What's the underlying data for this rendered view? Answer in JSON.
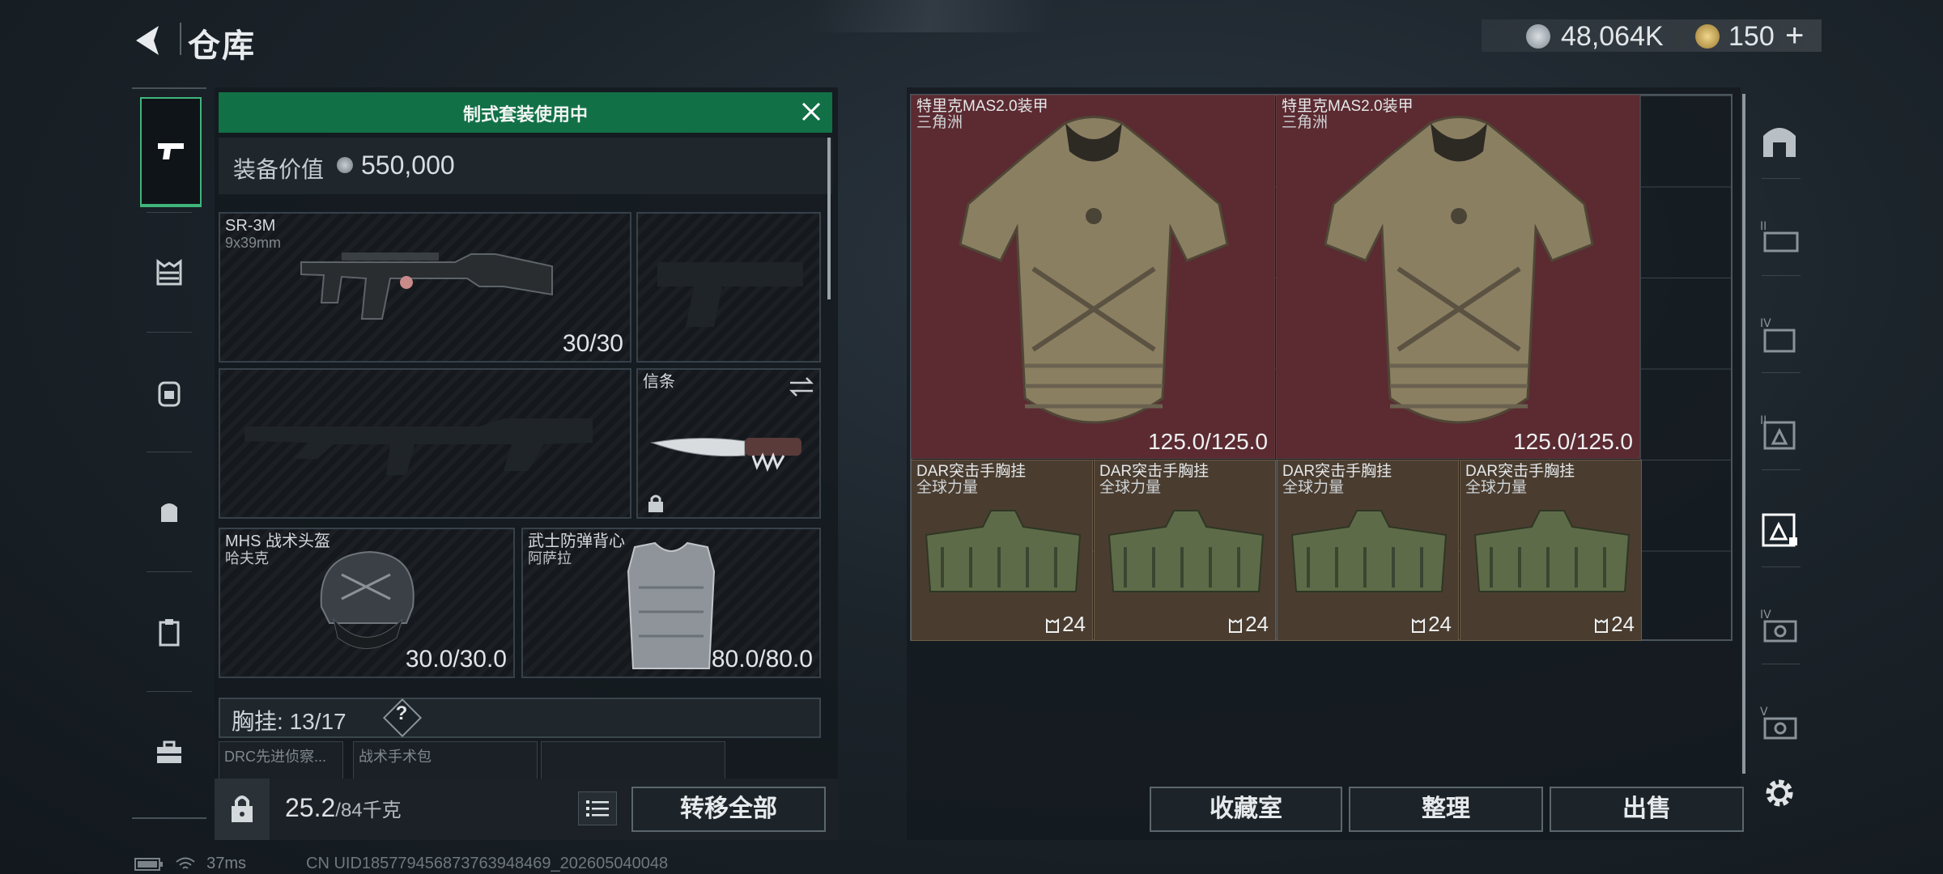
{
  "header": {
    "title": "仓库",
    "currency_primary": "48,064K",
    "currency_secondary": "150",
    "add_label": "+"
  },
  "tabs": [
    {
      "name": "weapons"
    },
    {
      "name": "rig"
    },
    {
      "name": "backpack"
    },
    {
      "name": "helmet-bag"
    },
    {
      "name": "clipboard"
    },
    {
      "name": "toolbox"
    }
  ],
  "loadout": {
    "banner": "制式套装使用中",
    "value_label": "装备价值",
    "value": "550,000",
    "primary_weapon": {
      "name": "SR-3M",
      "caliber": "9x39mm",
      "ammo": "30/30"
    },
    "melee": {
      "name": "信条"
    },
    "helmet": {
      "name": "MHS 战术头盔",
      "brand": "哈夫克",
      "durability": "30.0/30.0"
    },
    "armor": {
      "name": "武士防弹背心",
      "brand": "阿萨拉",
      "durability": "80.0/80.0"
    },
    "chest_label": "胸挂:",
    "chest_value": "13/17",
    "chest_help": "?",
    "pouches": [
      "DRC先进侦察...",
      "战术手术包",
      ""
    ],
    "weight": "25.2",
    "weight_max": "/84千克",
    "transfer_all": "转移全部"
  },
  "inventory": {
    "armors": [
      {
        "name": "特里克MAS2.0装甲",
        "brand": "三角洲",
        "durability": "125.0/125.0"
      },
      {
        "name": "特里克MAS2.0装甲",
        "brand": "三角洲",
        "durability": "125.0/125.0"
      }
    ],
    "rigs": [
      {
        "name": "DAR突击手胸挂",
        "brand": "全球力量",
        "capacity": "24"
      },
      {
        "name": "DAR突击手胸挂",
        "brand": "全球力量",
        "capacity": "24"
      },
      {
        "name": "DAR突击手胸挂",
        "brand": "全球力量",
        "capacity": "24"
      },
      {
        "name": "DAR突击手胸挂",
        "brand": "全球力量",
        "capacity": "24"
      }
    ],
    "buttons": {
      "collection": "收藏室",
      "sort": "整理",
      "sell": "出售"
    }
  },
  "status_bar": {
    "ping": "37ms",
    "uid": "CN UID185779456873763948469_202605040048"
  },
  "colors": {
    "accent_green": "#127047",
    "armor_bg": "#5b2b31",
    "rig_bg": "#4a3d30"
  }
}
